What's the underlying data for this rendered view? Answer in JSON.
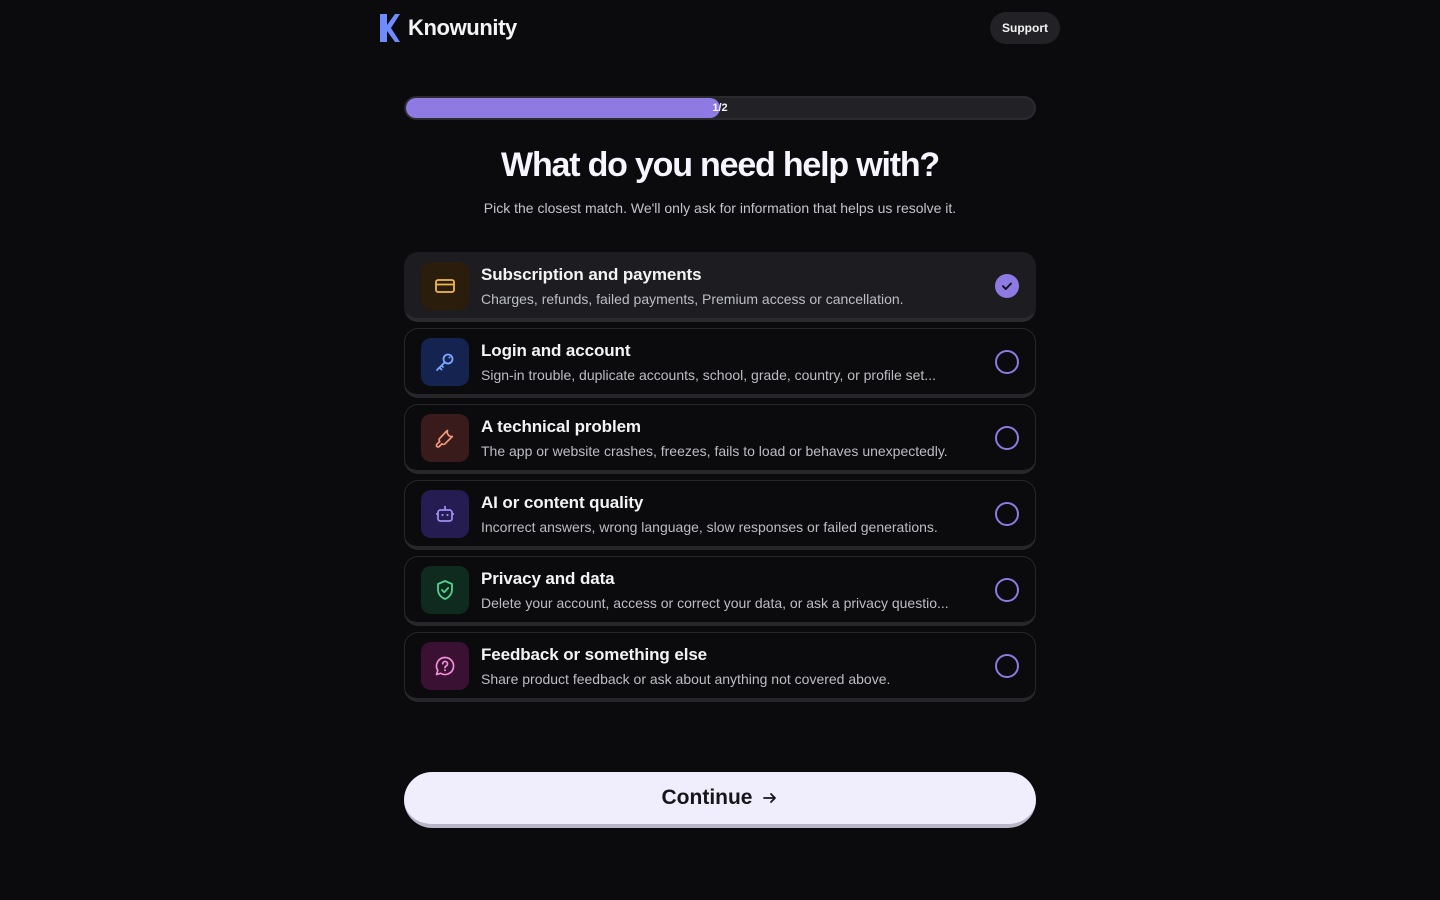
{
  "header": {
    "brand": "Knowunity",
    "support_label": "Support"
  },
  "progress": {
    "label": "1/2",
    "fraction": 0.5
  },
  "page": {
    "title": "What do you need help with?",
    "subtitle": "Pick the closest match. We'll only ask for information that helps us resolve it."
  },
  "options": [
    {
      "title": "Subscription and payments",
      "description": "Charges, refunds, failed payments, Premium access or cancellation.",
      "icon": "credit-card-icon",
      "icon_color": "#f0b94a",
      "icon_bg": "#2a1d0b",
      "selected": true
    },
    {
      "title": "Login and account",
      "description": "Sign-in trouble, duplicate accounts, school, grade, country, or profile set...",
      "icon": "key-icon",
      "icon_color": "#7aa7ff",
      "icon_bg": "#142350",
      "selected": false
    },
    {
      "title": "A technical problem",
      "description": "The app or website crashes, freezes, fails to load or behaves unexpectedly.",
      "icon": "wrench-icon",
      "icon_color": "#f39a7c",
      "icon_bg": "#3a1b1b",
      "selected": false
    },
    {
      "title": "AI or content quality",
      "description": "Incorrect answers, wrong language, slow responses or failed generations.",
      "icon": "robot-icon",
      "icon_color": "#9b8ff0",
      "icon_bg": "#251c52",
      "selected": false
    },
    {
      "title": "Privacy and data",
      "description": "Delete your account, access or correct your data, or ask a privacy questio...",
      "icon": "shield-check-icon",
      "icon_color": "#4fd38f",
      "icon_bg": "#0f2a1e",
      "selected": false
    },
    {
      "title": "Feedback or something else",
      "description": "Share product feedback or ask about anything not covered above.",
      "icon": "help-bubble-icon",
      "icon_color": "#f08fd8",
      "icon_bg": "#3a1133",
      "selected": false
    }
  ],
  "continue_label": "Continue",
  "accent_color": "#8f7ae3"
}
